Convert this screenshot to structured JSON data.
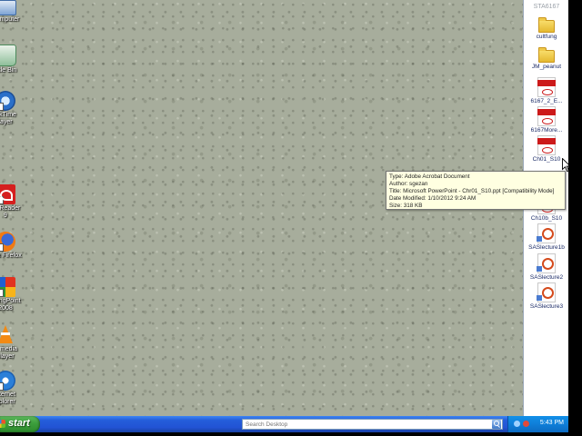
{
  "side_window": {
    "header": "STA6167",
    "items": [
      {
        "label": "cultfung",
        "icon": "folder-icon"
      },
      {
        "label": "JM_peanut",
        "icon": "folder-icon"
      },
      {
        "label": "6167_2_E...",
        "icon": "pdf-file-icon"
      },
      {
        "label": "6167More...",
        "icon": "pdf-file-icon"
      },
      {
        "label": "Ch01_S10",
        "icon": "pdf-file-icon"
      },
      {
        "label": "Ch10b_S10",
        "icon": "pdf-file-icon"
      },
      {
        "label": "SASlecture1b",
        "icon": "ppt-file-icon"
      },
      {
        "label": "SASlecture2",
        "icon": "ppt-file-icon"
      },
      {
        "label": "SASlecture3",
        "icon": "ppt-file-icon"
      }
    ]
  },
  "desktop_icons": [
    {
      "label": "Computer",
      "icon": "computer-icon"
    },
    {
      "label": "ycle Bin",
      "icon": "recycle-bin-icon"
    },
    {
      "label": "ickTime",
      "label2": "layer",
      "icon": "quicktime-icon"
    },
    {
      "label": "be Reader",
      "label2": "9",
      "icon": "adobe-reader-icon"
    },
    {
      "label": "zilla Firefox",
      "icon": "firefox-icon"
    },
    {
      "label": "ndingPoint",
      "label2": "2008",
      "icon": "gadget-icon"
    },
    {
      "label": "C media",
      "label2": "player",
      "icon": "vlc-icon"
    },
    {
      "label": "nternet",
      "label2": "xplorer",
      "icon": "internet-explorer-icon"
    }
  ],
  "tooltip": {
    "type": "Type: Adobe Acrobat Document",
    "author": "Author: sgezan",
    "title": "Title: Microsoft PowerPoint - Chr01_S10.ppt [Compatibility Mode]",
    "date_modified": "Date Modified: 1/10/2012 9:24 AM",
    "size": "Size: 318 KB"
  },
  "taskbar": {
    "start_label": "start",
    "search_placeholder": "Search Desktop",
    "clock": "5:43 PM"
  },
  "colors": {
    "taskbar_blue": "#245edb",
    "start_green": "#3c9e3c",
    "tooltip_bg": "#ffffe1",
    "wallpaper": "#a7ad9c"
  }
}
